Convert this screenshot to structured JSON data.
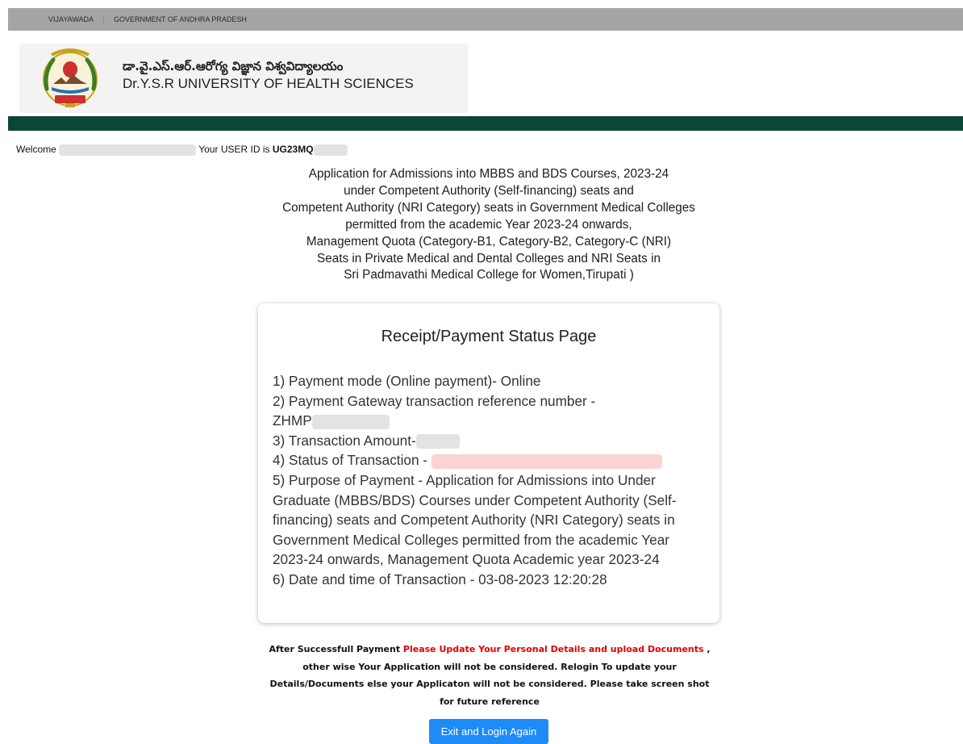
{
  "topbar": {
    "link_1": "VIJAYAWADA",
    "link_2": "GOVERNMENT OF ANDHRA PRADESH"
  },
  "header": {
    "telugu_name": "డా.వై.ఎస్.ఆర్.ఆరోగ్య విజ్ఞాన విశ్వవిద్యాలయం",
    "english_name": "Dr.Y.S.R UNIVERSITY OF HEALTH SCIENCES"
  },
  "welcome": {
    "prefix": "Welcome",
    "userid_label": "Your USER ID is",
    "userid_value": "UG23MQ"
  },
  "application_title": [
    "Application for Admissions into MBBS and BDS Courses, 2023-24",
    "under Competent Authority (Self-financing) seats and",
    "Competent Authority (NRI Category) seats in Government Medical Colleges",
    "permitted from the academic Year 2023-24 onwards,",
    "Management Quota (Category-B1, Category-B2, Category-C (NRI)",
    "Seats in Private Medical and Dental Colleges and NRI Seats in",
    "Sri Padmavathi Medical College for Women,Tirupati )"
  ],
  "receipt": {
    "title": "Receipt/Payment Status Page",
    "item_1": "1) Payment mode (Online payment)- Online",
    "item_2": "2) Payment Gateway transaction reference number -",
    "item_2_value": "ZHMP",
    "item_3": "3) Transaction Amount-",
    "item_4": "4) Status of Transaction -",
    "item_5": "5) Purpose of Payment - Application for Admissions into Under Graduate (MBBS/BDS) Courses under Competent Authority (Self-financing) seats and Competent Authority (NRI Category) seats in Government Medical Colleges permitted from the academic Year 2023-24 onwards, Management Quota Academic year 2023-24",
    "item_6": "6) Date and time of Transaction - 03-08-2023 12:20:28"
  },
  "notice": {
    "part_1": "After Successfull Payment ",
    "part_2_red": "Please Update Your Personal Details and upload Documents",
    "part_3": " , other wise Your Application will not be considered. Relogin To update your Details/Documents else your Applicaton will not be considered. Please take screen shot for future reference"
  },
  "buttons": {
    "exit_label": "Exit and Login Again"
  },
  "colors": {
    "green_band": "#0b4638",
    "button_blue": "#1d8cf8",
    "notice_red": "#e00000",
    "topbar_gray": "#a5a5a5"
  }
}
